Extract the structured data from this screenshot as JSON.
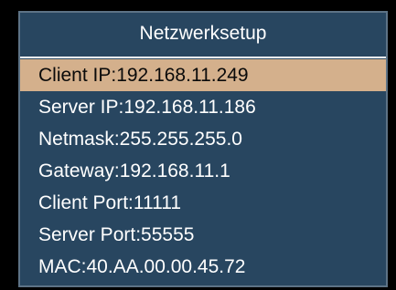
{
  "menu": {
    "title": "Netzwerksetup",
    "colors": {
      "panel_background": "#284660",
      "selected_background": "#d4b08c",
      "text": "#ffffff",
      "selected_text": "#0a0a0a"
    },
    "selected_index": 0,
    "items": [
      {
        "label": "Client IP:192.168.11.249"
      },
      {
        "label": "Server IP:192.168.11.186"
      },
      {
        "label": "Netmask:255.255.255.0"
      },
      {
        "label": "Gateway:192.168.11.1"
      },
      {
        "label": "Client Port:11111"
      },
      {
        "label": "Server Port:55555"
      },
      {
        "label": "MAC:40.AA.00.00.45.72"
      }
    ]
  }
}
